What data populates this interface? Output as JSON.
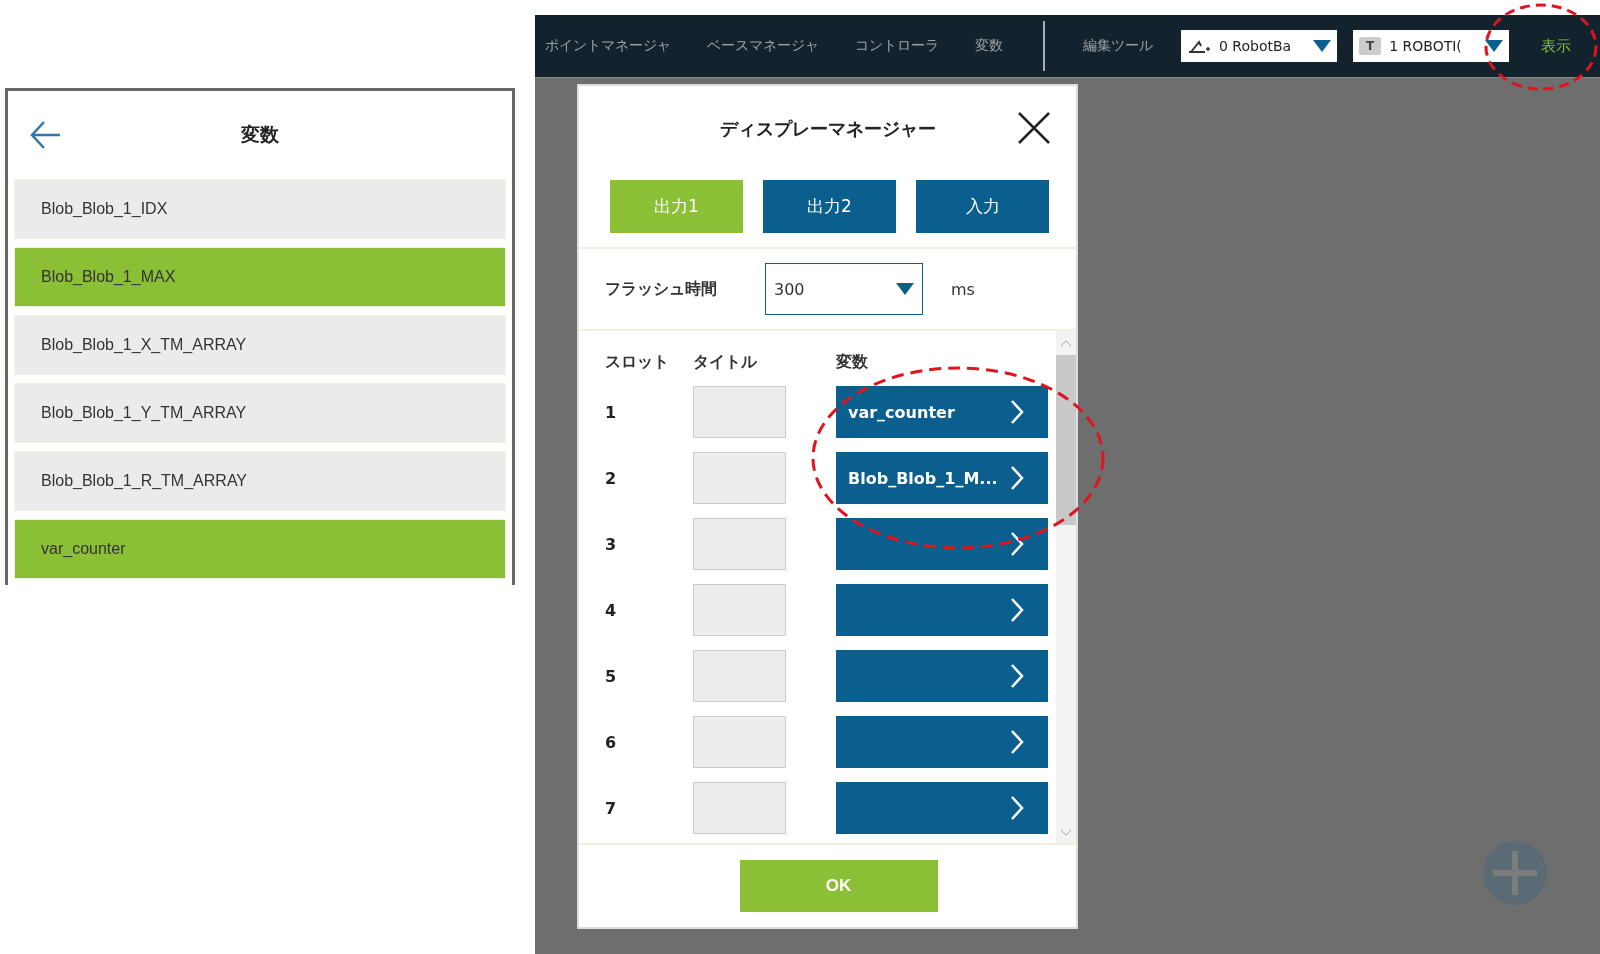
{
  "variables_panel": {
    "title": "変数",
    "items": [
      {
        "label": "Blob_Blob_1_IDX",
        "selected": false
      },
      {
        "label": "Blob_Blob_1_MAX",
        "selected": true
      },
      {
        "label": "Blob_Blob_1_X_TM_ARRAY",
        "selected": false
      },
      {
        "label": "Blob_Blob_1_Y_TM_ARRAY",
        "selected": false
      },
      {
        "label": "Blob_Blob_1_R_TM_ARRAY",
        "selected": false
      },
      {
        "label": "var_counter",
        "selected": true
      }
    ]
  },
  "top_bar": {
    "menu": [
      "ポイントマネージャ",
      "ベースマネージャ",
      "コントローラ",
      "変数"
    ],
    "edit_tool": "編集ツール",
    "dropdowns": [
      {
        "kind": "base",
        "value": "0 RobotBa"
      },
      {
        "kind": "tool",
        "badge": "T",
        "value": "1 ROBOTI("
      }
    ],
    "display_button": "表示"
  },
  "dialog": {
    "title": "ディスプレーマネージャー",
    "tabs": [
      {
        "label": "出力1",
        "selected": true
      },
      {
        "label": "出力2",
        "selected": false
      },
      {
        "label": "入力",
        "selected": false
      }
    ],
    "flash_time": {
      "label": "フラッシュ時間",
      "value": "300",
      "unit": "ms"
    },
    "columns": [
      "スロット",
      "タイトル",
      "変数"
    ],
    "slots": [
      {
        "number": "1",
        "variable": "var_counter"
      },
      {
        "number": "2",
        "variable": "Blob_Blob_1_M..."
      },
      {
        "number": "3"
      },
      {
        "number": "4"
      },
      {
        "number": "5"
      },
      {
        "number": "6"
      },
      {
        "number": "7"
      }
    ],
    "ok_button": "OK"
  }
}
